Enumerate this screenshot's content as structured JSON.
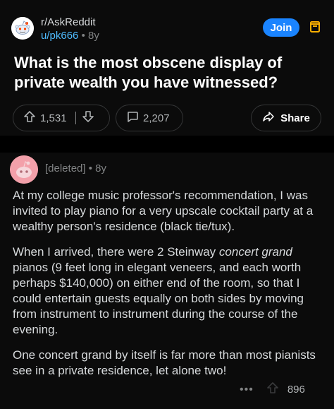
{
  "post": {
    "subreddit": "r/AskReddit",
    "user": "u/pk666",
    "age": "8y",
    "join_label": "Join",
    "title": "What is the most obscene display of private wealth you have witnessed?",
    "upvotes": "1,531",
    "comments": "2,207",
    "share_label": "Share"
  },
  "comment": {
    "author": "[deleted]",
    "age": "8y",
    "para1": "At my college music professor's recommendation, I was invited to play piano for a very upscale cocktail party at a wealthy person's residence (black tie/tux).",
    "para2_a": "When I arrived, there were 2 Steinway ",
    "para2_em": "concert grand",
    "para2_b": " pianos (9 feet long in elegant veneers, and each worth perhaps $140,000) on either end of the room, so that I could entertain guests equally on both sides by moving from instrument to instrument during the course of the evening.",
    "para3": "One concert grand by itself is far more than most pianists see in a private residence, let alone two!",
    "more": "•••",
    "votes": "896"
  },
  "colors": {
    "accent": "#1a84ff",
    "link": "#4fbcff",
    "tray": "#ffb000",
    "avatar_pink": "#f3a0aa"
  },
  "icons": [
    "snoo-avatar-icon",
    "tray-icon",
    "upvote-icon",
    "downvote-icon",
    "comment-icon",
    "share-icon",
    "deleted-avatar-icon"
  ]
}
